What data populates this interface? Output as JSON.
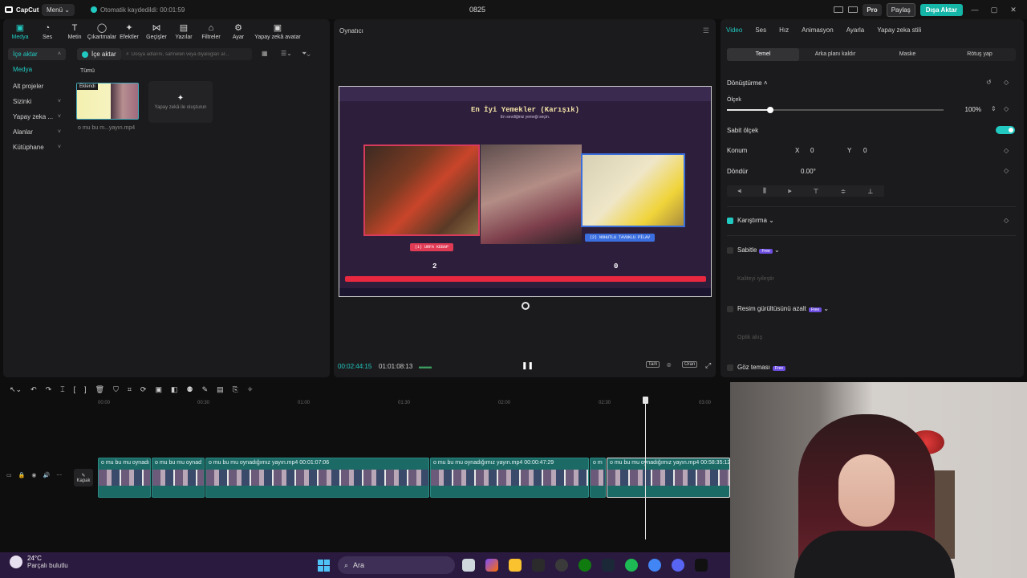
{
  "titlebar": {
    "logo": "CapCut",
    "menu_label": "Menü",
    "autosave": "Otomatik kaydedildi: 00:01:59",
    "project_title": "0825",
    "pro_label": "Pro",
    "share_label": "Paylaş",
    "export_label": "Dışa Aktar",
    "min": "—",
    "max": "▢",
    "close": "✕"
  },
  "tooltabs": [
    {
      "label": "Medya",
      "icon": "▣"
    },
    {
      "label": "Ses",
      "icon": "◔"
    },
    {
      "label": "Metin",
      "icon": "T"
    },
    {
      "label": "Çıkartmalar",
      "icon": "◯"
    },
    {
      "label": "Efektler",
      "icon": "✦"
    },
    {
      "label": "Geçişler",
      "icon": "⋈"
    },
    {
      "label": "Yazılar",
      "icon": "▤"
    },
    {
      "label": "Filtreler",
      "icon": "⌂"
    },
    {
      "label": "Ayar",
      "icon": "⚙"
    },
    {
      "label": "Yapay zekâ avatar",
      "icon": "▣"
    }
  ],
  "sidebar": {
    "items": [
      {
        "label": "İçe aktar",
        "chev": "˄"
      },
      {
        "label": "Medya",
        "chev": ""
      },
      {
        "label": "Alt projeler",
        "chev": ""
      },
      {
        "label": "Sizinki",
        "chev": "˅"
      },
      {
        "label": "Yapay zeka ...",
        "chev": "˅"
      },
      {
        "label": "Alanlar",
        "chev": "˅"
      },
      {
        "label": "Kütüphane",
        "chev": "˅"
      }
    ]
  },
  "media": {
    "import_label": "İçe aktar",
    "search_placeholder": "Dosya adlarını, sahneleri veya diyalogları ar...",
    "all_label": "Tümü",
    "added_badge": "Eklendi",
    "file_name": "o mu bu m...yayın.mp4",
    "ai_card_label": "Yapay zekâ ile oluşturun"
  },
  "player": {
    "title": "Oynatıcı",
    "current_time": "00:02:44:15",
    "duration": "01:01:08:13",
    "full_label": "Tam",
    "ratio_label": "Oran",
    "video": {
      "title": "En İyi Yemekler (Karışık)",
      "subtitle": "En sevdiğiniz yemeği seçin.",
      "left_label": "(1) URFA KEBAP",
      "right_label": "(2) NOHUTLU TAVUKLU PİLAV",
      "left_score": "2",
      "right_score": "0"
    }
  },
  "inspector": {
    "tabs": [
      "Video",
      "Ses",
      "Hız",
      "Animasyon",
      "Ayarla",
      "Yapay zeka stili"
    ],
    "subtabs": [
      "Temel",
      "Arka planı kaldır",
      "Maske",
      "Rötuş yap"
    ],
    "transform_label": "Dönüştürme",
    "scale_label": "Ölçek",
    "scale_value": "100%",
    "scale_fraction": 0.2,
    "uniform_scale_label": "Sabit ölçek",
    "position_label": "Konum",
    "pos_x_label": "X",
    "pos_x": "0",
    "pos_y_label": "Y",
    "pos_y": "0",
    "rotate_label": "Döndür",
    "rotate_value": "0.00°",
    "blend_label": "Karıştırma",
    "stabilize_label": "Sabitle",
    "free_badge": "Free",
    "enhance_label": "Kaliteyi iyileştir",
    "denoise_label": "Resim gürültüsünü azalt",
    "optical_label": "Optik akış",
    "eye_label": "Göz teması"
  },
  "timeline": {
    "ruler": [
      "00:00",
      "00:30",
      "01:00",
      "01:30",
      "02:00",
      "02:30",
      "03:00"
    ],
    "cover_label": "Kapak",
    "clips": [
      {
        "label": "o mu bu mu oynadı"
      },
      {
        "label": "o mu bu mu oynad"
      },
      {
        "label": "o mu bu mu oynadığımız yayın.mp4  00:01:07:06"
      },
      {
        "label": "o mu bu mu oynadığımız yayın.mp4  00:00:47:29"
      },
      {
        "label": "o m"
      },
      {
        "label": "o mu bu mu oynadığımız yayın.mp4  00:58:35:12"
      }
    ]
  },
  "taskbar": {
    "temp": "24°C",
    "weather": "Parçalı bulutlu",
    "search": "Ara"
  },
  "colors": {
    "accent": "#21c9c1",
    "export": "#15b5a8"
  }
}
